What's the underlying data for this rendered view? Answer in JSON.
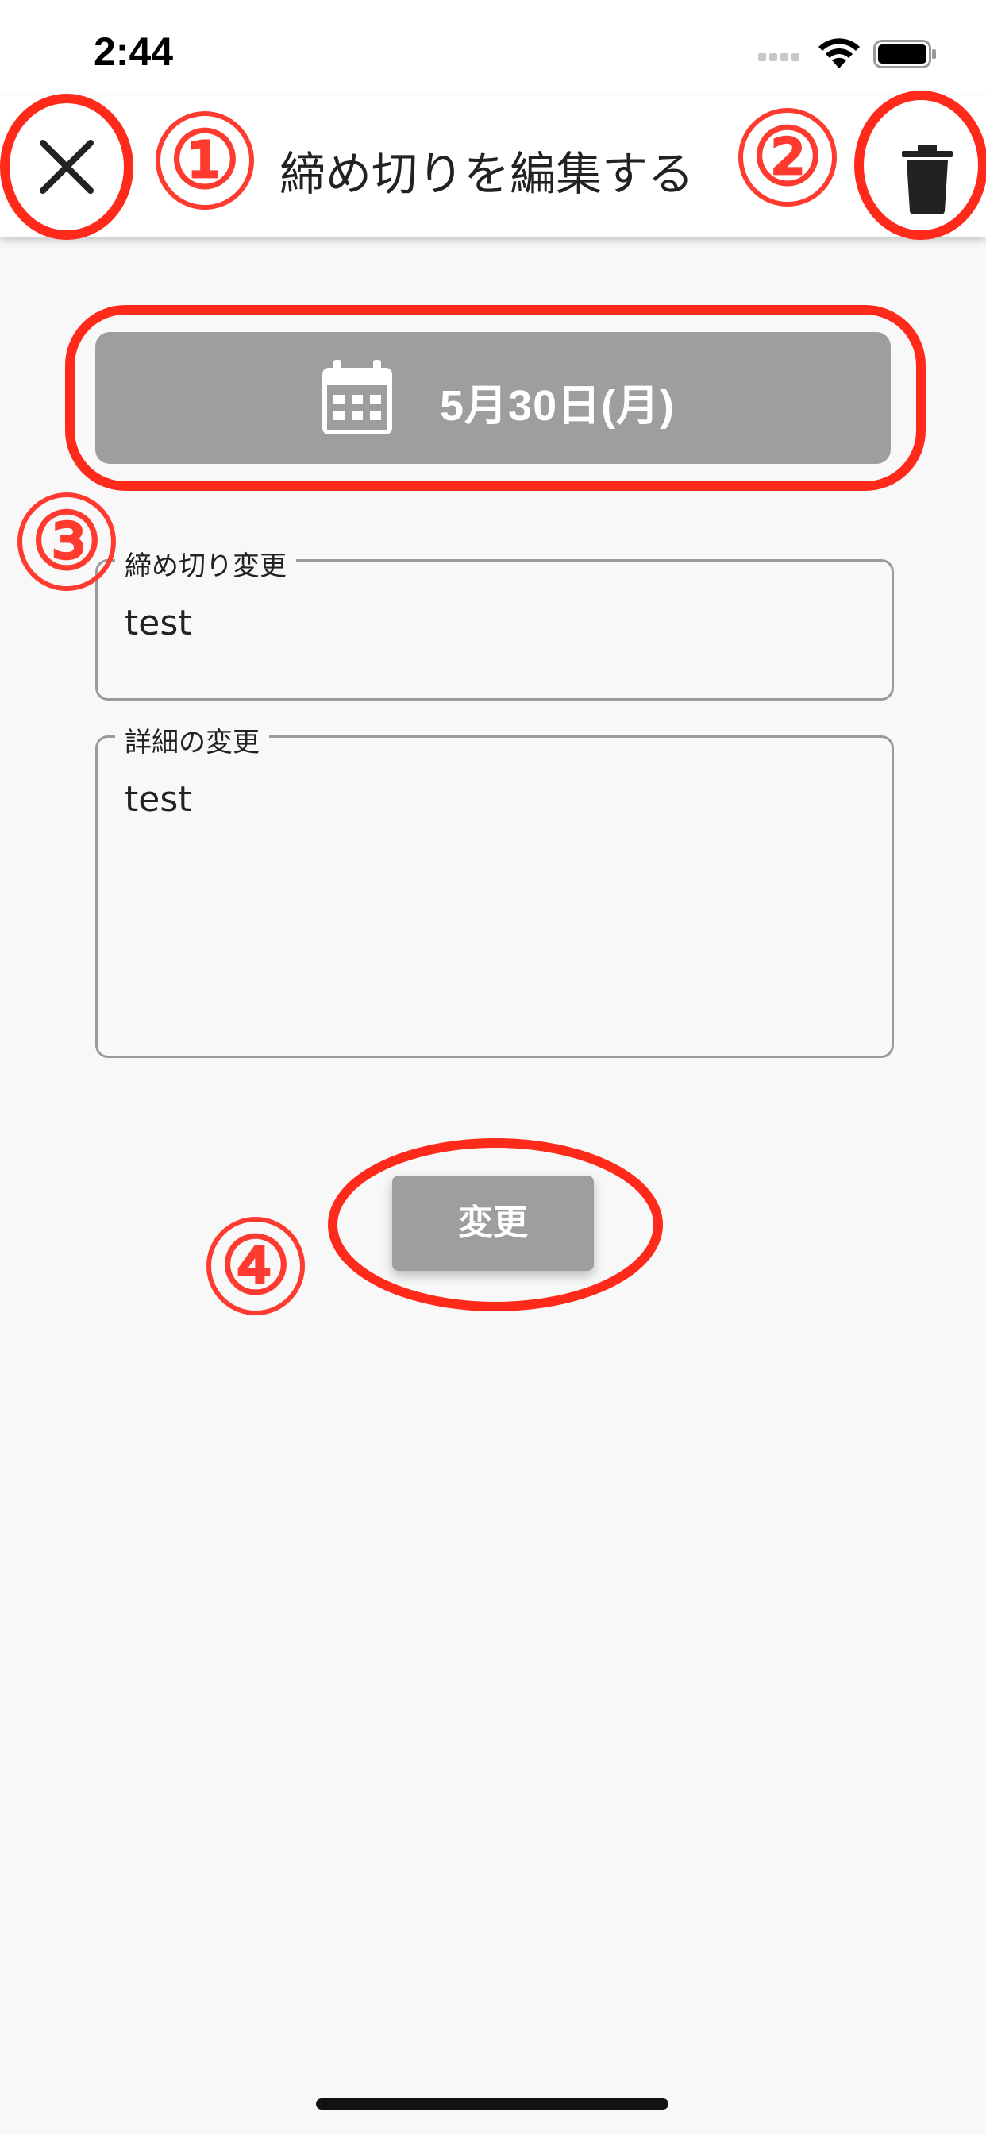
{
  "status_bar": {
    "time": "2:44"
  },
  "app_bar": {
    "title": "締め切りを編集する",
    "close_icon": "close-icon",
    "delete_icon": "trash-icon"
  },
  "date_button": {
    "label": "5月30日(月)",
    "icon": "calendar-icon"
  },
  "fields": {
    "deadline": {
      "label": "締め切り変更",
      "value": "test"
    },
    "details": {
      "label": "詳細の変更",
      "value": "test"
    }
  },
  "submit_button": {
    "label": "変更"
  },
  "annotations": [
    "①",
    "②",
    "③",
    "④"
  ],
  "colors": {
    "annotation": "#ff2a1a",
    "button_gray": "#9e9e9e",
    "background": "#f8f8f8"
  }
}
